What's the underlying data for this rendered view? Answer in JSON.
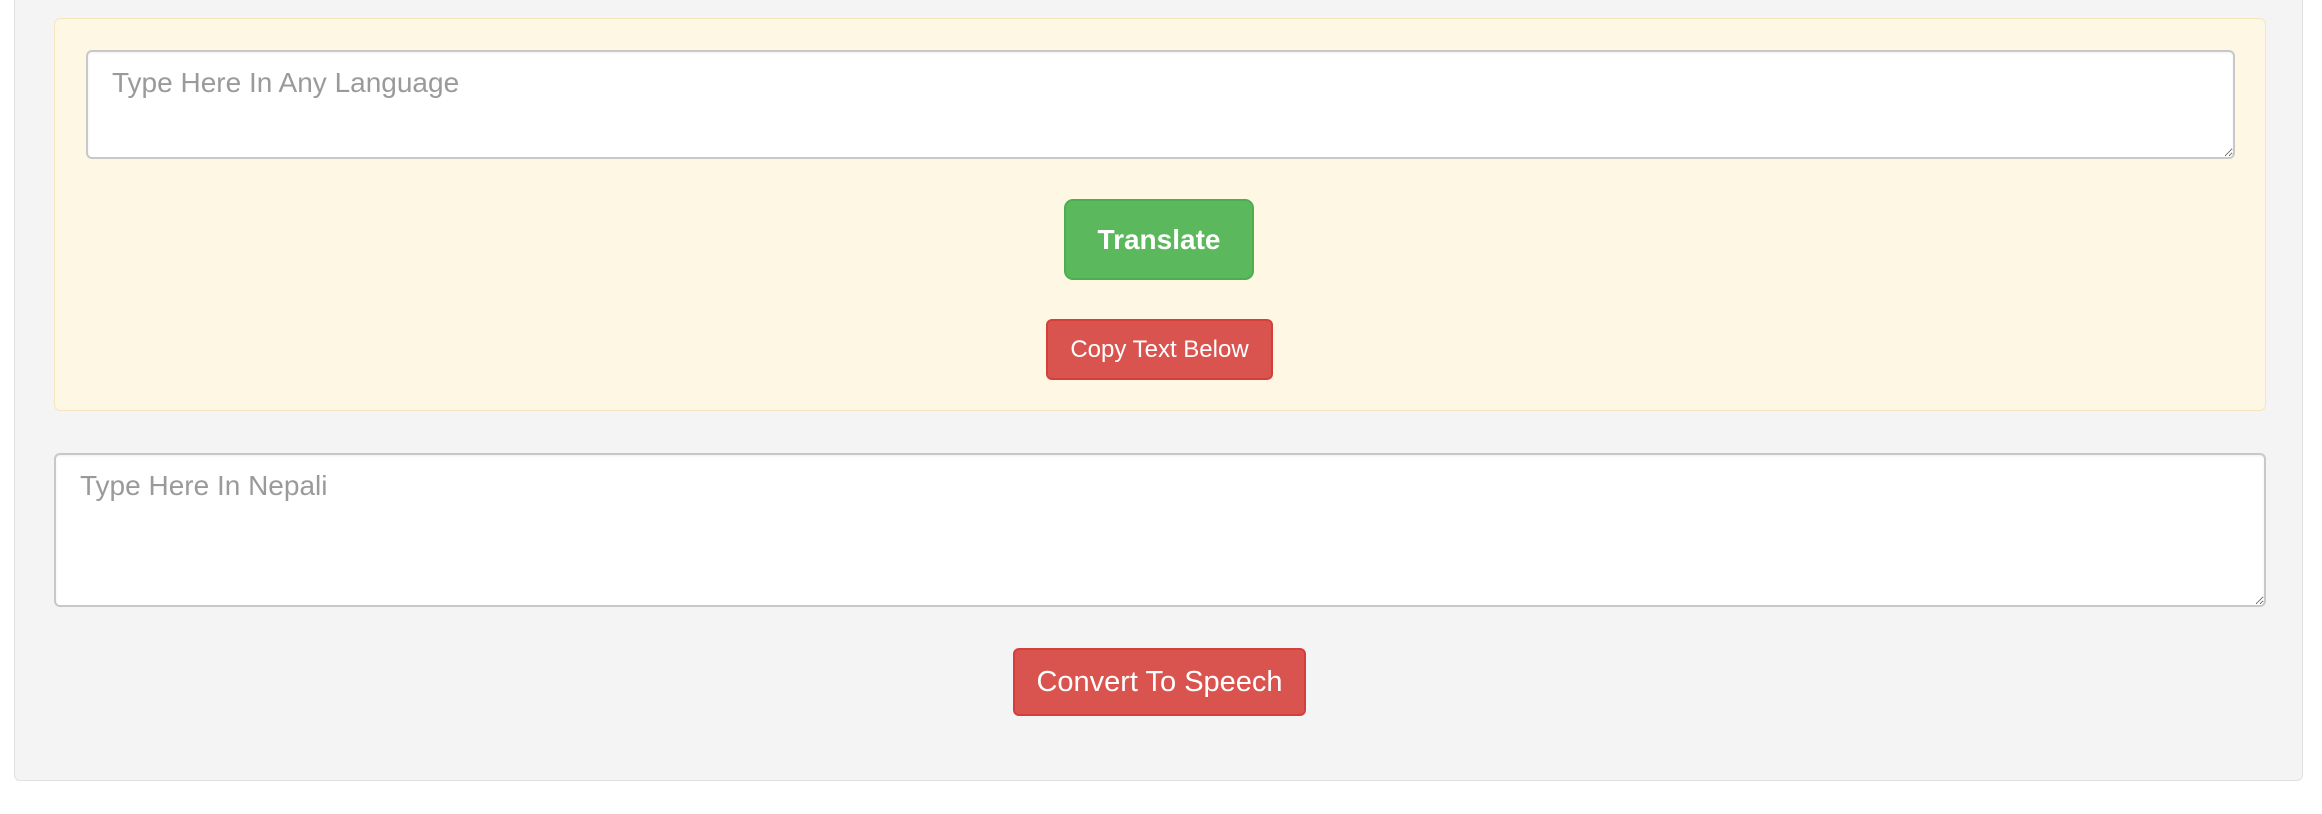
{
  "translator": {
    "source_placeholder": "Type Here In Any Language",
    "translate_label": "Translate",
    "copy_label": "Copy Text Below"
  },
  "nepali": {
    "placeholder": "Type Here In Nepali",
    "speech_label": "Convert To Speech"
  },
  "colors": {
    "success": "#5cb85c",
    "danger": "#d9534f",
    "panel_bg": "#fdf7e3",
    "well_bg": "#f4f4f4"
  }
}
